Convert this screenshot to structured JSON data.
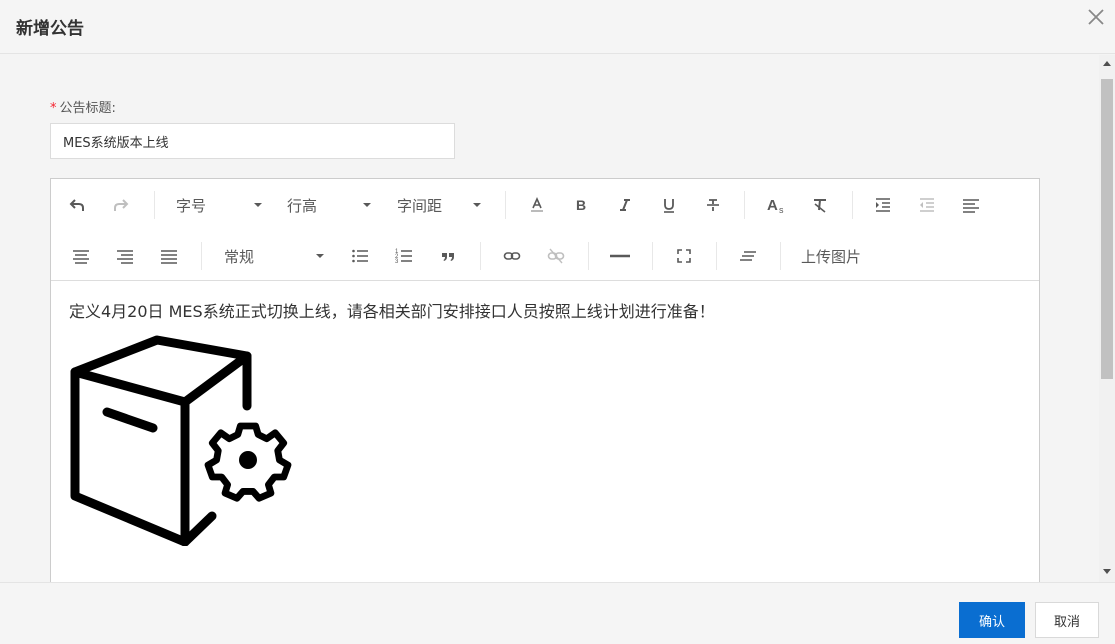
{
  "dialog": {
    "title": "新增公告",
    "close_icon": "close-icon"
  },
  "form": {
    "title_label": "公告标题:",
    "required_mark": "*",
    "title_value": "MES系统版本上线"
  },
  "toolbar": {
    "font_size": "字号",
    "line_height": "行高",
    "letter_spacing": "字间距",
    "paragraph_style": "常规",
    "upload_image": "上传图片",
    "icons_row1": [
      "undo-icon",
      "redo-icon",
      "font-color-icon",
      "bold-icon",
      "italic-icon",
      "underline-icon",
      "strikethrough-icon",
      "superscript-icon",
      "clear-format-icon",
      "indent-icon",
      "outdent-icon",
      "align-left-icon"
    ],
    "icons_row2": [
      "align-center-icon",
      "align-right-icon",
      "align-justify-icon",
      "unordered-list-icon",
      "ordered-list-icon",
      "blockquote-icon",
      "link-icon",
      "unlink-icon",
      "horizontal-rule-icon",
      "fullscreen-icon",
      "clear-icon"
    ]
  },
  "editor": {
    "content_text": "定义4月20日 MES系统正式切换上线，请各相关部门安排接口人员按照上线计划进行准备！",
    "image_icon": "package-settings-icon"
  },
  "footer": {
    "confirm_label": "确认",
    "cancel_label": "取消"
  },
  "colors": {
    "primary": "#0a6ed1",
    "required": "#f5222d"
  }
}
